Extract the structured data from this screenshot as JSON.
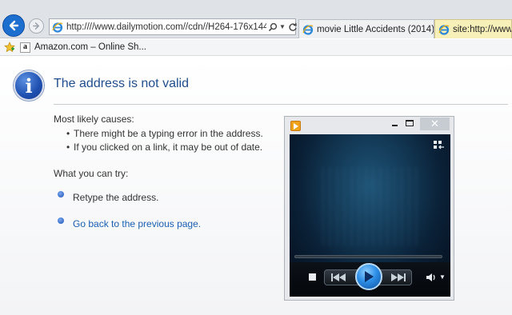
{
  "browser": {
    "address_url": "http:////www.dailymotion.com//cdn//H264-176x144-",
    "tabs": [
      {
        "label": "movie Little Accidents (2014) - ..."
      },
      {
        "label": "site:http://www.d"
      }
    ],
    "favorites": [
      {
        "label": "Amazon.com – Online Sh..."
      }
    ],
    "icons": [
      "back-arrow-icon",
      "forward-arrow-icon",
      "ie-logo-icon",
      "search-icon",
      "refresh-icon",
      "favorites-star-icon",
      "amazon-icon"
    ]
  },
  "error_page": {
    "heading": "The address is not valid",
    "causes_title": "Most likely causes:",
    "causes": [
      "There might be a typing error in the address.",
      "If you clicked on a link, it may be out of date."
    ],
    "try_title": "What you can try:",
    "actions": [
      "Retype the address.",
      "Go back to the previous page."
    ],
    "heading_color": "#1f4e8f",
    "link_color": "#1a5fb4"
  },
  "media_player": {
    "window_buttons": {
      "close": "✕"
    },
    "icons": [
      "media-player-icon",
      "switch-view-icon",
      "stop-icon",
      "previous-icon",
      "play-icon",
      "next-icon",
      "volume-icon"
    ]
  }
}
